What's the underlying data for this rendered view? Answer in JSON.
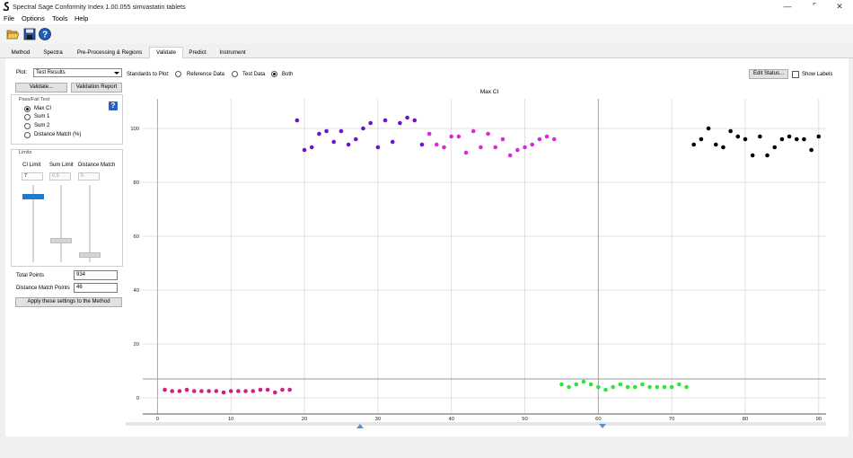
{
  "window": {
    "title": "Spectral Sage Conformity Index 1.00.055 simvastatin tablets",
    "minimize": "—",
    "maximize": "⌜",
    "close": "✕"
  },
  "menu": [
    "File",
    "Options",
    "Tools",
    "Help"
  ],
  "toolbar": {
    "open_icon": "folder-open-icon",
    "save_icon": "save-disk-icon",
    "help_icon": "help-icon"
  },
  "tabs": [
    {
      "label": "Method",
      "active": false
    },
    {
      "label": "Spectra",
      "active": false
    },
    {
      "label": "Pre-Processing & Regions",
      "active": false
    },
    {
      "label": "Validate",
      "active": true
    },
    {
      "label": "Predict",
      "active": false
    },
    {
      "label": "Instrument",
      "active": false
    }
  ],
  "controls": {
    "plot_label": "Plot:",
    "plot_value": "Test Results",
    "standards_label": "Standards to Plot:",
    "radio_reference": "Reference Data",
    "radio_test": "Test Data",
    "radio_both": "Both",
    "edit_status_button": "Edit Status...",
    "show_labels": "Show Labels",
    "validate_button": "Validate...",
    "validation_report_button": "Validation Report"
  },
  "passfail": {
    "title": "Pass/Fail Test",
    "options": [
      "Max CI",
      "Sum 1",
      "Sum 2",
      "Distance Match (%)"
    ],
    "selected": 0,
    "info": "?"
  },
  "limits": {
    "title": "Limits",
    "ci_limit_label": "CI Limit",
    "sum_limit_label": "Sum Limit",
    "distance_match_label": "Distance Match",
    "ci_limit_value": "7",
    "sum_limit_value": "0.5",
    "distance_match_value": "5",
    "ci_slider": 0.07,
    "sum_slider": 0.005,
    "distance_slider": 0.05
  },
  "totals": {
    "total_points_label": "Total Points",
    "total_points_value": "934",
    "distance_match_points_label": "Distance Match Points",
    "distance_match_points_value": "46",
    "apply_button": "Apply these settings to the Method"
  },
  "chart_data": {
    "type": "scatter",
    "title": "Max CI",
    "xlabel": "",
    "ylabel": "",
    "xlim": [
      -2,
      91
    ],
    "ylim": [
      -6,
      111
    ],
    "xticks": [
      0,
      10,
      20,
      30,
      40,
      50,
      60,
      70,
      80,
      90
    ],
    "yticks": [
      0,
      20,
      40,
      60,
      80,
      100
    ],
    "threshold": 7,
    "grid": true,
    "colors": {
      "pink": "#d11d86",
      "purple": "#6a16c9",
      "magenta": "#dc2ad6",
      "green": "#2ee63a",
      "black": "#000000",
      "threshold": "#999999"
    },
    "series": [
      {
        "color": "pink",
        "x": [
          1,
          2,
          3,
          4,
          5,
          6,
          7,
          8,
          9,
          10,
          11,
          12,
          13,
          14,
          15,
          16,
          17,
          18
        ],
        "y": [
          3,
          2.5,
          2.5,
          3,
          2.5,
          2.5,
          2.5,
          2.5,
          2,
          2.5,
          2.5,
          2.5,
          2.5,
          3,
          3,
          2,
          3,
          3
        ]
      },
      {
        "color": "purple",
        "x": [
          19,
          20,
          21,
          22,
          23,
          24,
          25,
          26,
          27,
          28,
          29,
          30,
          31,
          32,
          33,
          34,
          35,
          36
        ],
        "y": [
          103,
          92,
          93,
          98,
          99,
          95,
          99,
          94,
          96,
          100,
          102,
          93,
          103,
          95,
          102,
          104,
          103,
          94
        ]
      },
      {
        "color": "magenta",
        "x": [
          37,
          38,
          39,
          40,
          41,
          42,
          43,
          44,
          45,
          46,
          47,
          48,
          49,
          50,
          51,
          52,
          53,
          54
        ],
        "y": [
          98,
          94,
          93,
          97,
          97,
          91,
          99,
          93,
          98,
          93,
          96,
          90,
          92,
          93,
          94,
          96,
          97,
          96
        ]
      },
      {
        "color": "green",
        "x": [
          55,
          56,
          57,
          58,
          59,
          60,
          61,
          62,
          63,
          64,
          65,
          66,
          67,
          68,
          69,
          70,
          71,
          72
        ],
        "y": [
          5,
          4,
          5,
          6,
          5,
          4,
          3,
          4,
          5,
          4,
          4,
          5,
          4,
          4,
          4,
          4,
          5,
          4
        ]
      },
      {
        "color": "black",
        "x": [
          73,
          74,
          75,
          76,
          77,
          78,
          79,
          80,
          81,
          82,
          83,
          84,
          85,
          86,
          87,
          88,
          89,
          90
        ],
        "y": [
          94,
          96,
          100,
          94,
          93,
          99,
          97,
          96,
          90,
          97,
          90,
          93,
          96,
          97,
          96,
          96,
          92,
          97
        ]
      }
    ]
  }
}
